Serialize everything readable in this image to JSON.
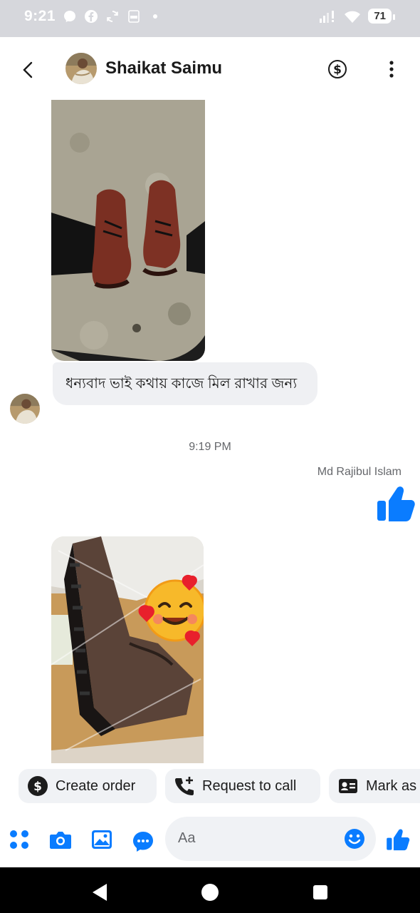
{
  "status": {
    "time": "9:21",
    "battery": "71",
    "colors": {
      "bar": "#d6d7dc"
    }
  },
  "header": {
    "contact_name": "Shaikat Saimu",
    "back_icon": "chevron-left-icon",
    "dollar_icon": "dollar-circle-icon",
    "menu_icon": "vertical-dots-icon"
  },
  "conversation": {
    "incoming_text": "ধন্যবাদ  ভাই কথায় কাজে মিল রাখার জন্য",
    "timestamp": "9:19 PM",
    "outgoing_sender": "Md Rajibul Islam",
    "outgoing_reaction": "thumbs-up-icon"
  },
  "quick_actions": [
    {
      "label": "Create order",
      "icon": "dollar-circle-icon"
    },
    {
      "label": "Request to call",
      "icon": "phone-plus-icon"
    },
    {
      "label": "Mark as",
      "icon": "contact-card-icon"
    }
  ],
  "composer": {
    "placeholder": "Aa",
    "icons": [
      "grid-icon",
      "camera-icon",
      "image-icon",
      "chat-bubble-icon",
      "emoji-icon",
      "thumbs-up-icon"
    ]
  },
  "colors": {
    "accent": "#0a7cff",
    "bubble": "#eff0f3",
    "secondary_text": "#65676b"
  }
}
